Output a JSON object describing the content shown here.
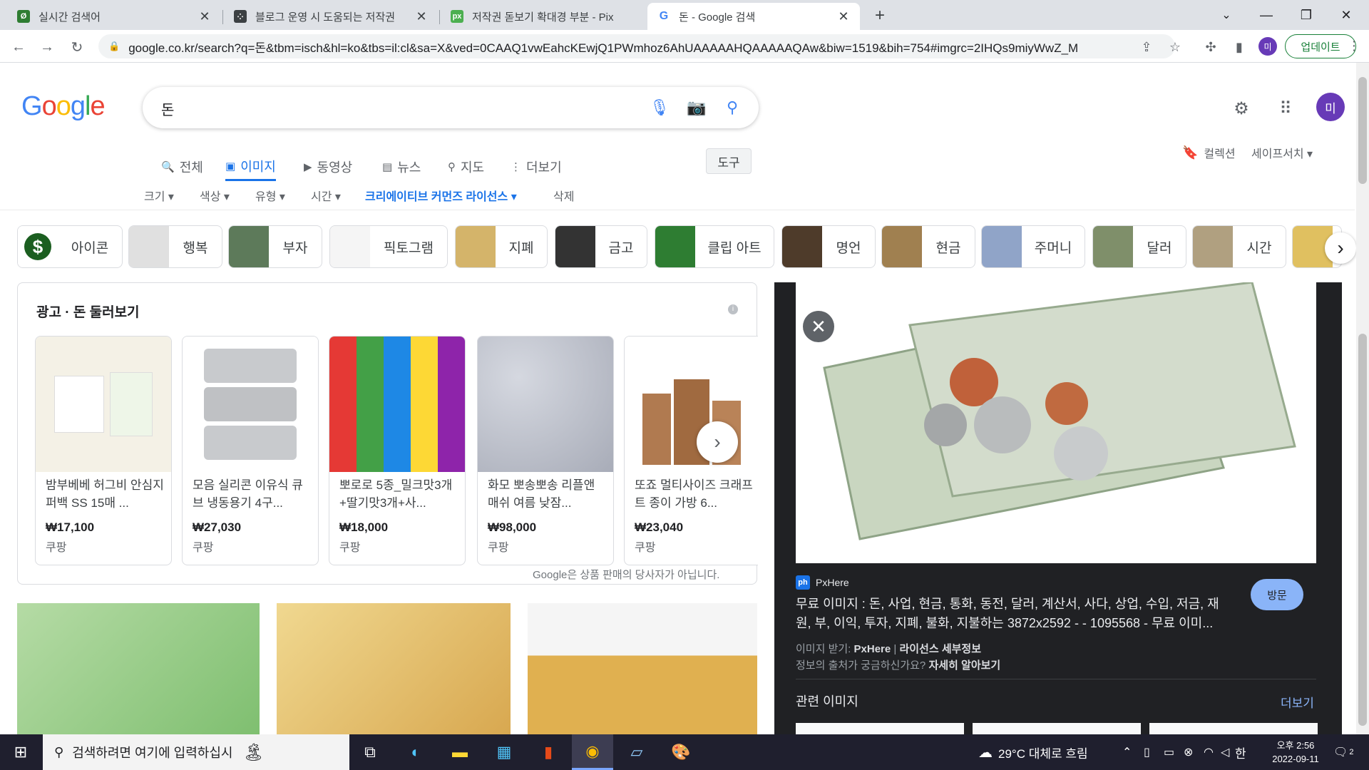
{
  "browser": {
    "tabs": [
      {
        "title": "실시간 검색어",
        "favicon_color": "#2e7d32",
        "favicon_glyph": "Ø"
      },
      {
        "title": "블로그 운영 시 도움되는 저작권",
        "favicon_color": "#3c4043",
        "favicon_glyph": "⁘"
      },
      {
        "title": "저작권 돋보기 확대경 부분 - Pix",
        "favicon_color": "#4caf50",
        "favicon_glyph": "px"
      },
      {
        "title": "돈 - Google 검색",
        "favicon_color": "#ffffff",
        "favicon_glyph": "G"
      }
    ],
    "url": "google.co.kr/search?q=돈&tbm=isch&hl=ko&tbs=il:cl&sa=X&ved=0CAAQ1vwEahcKEwjQ1PWmhoz6AhUAAAAAHQAAAAAQAw&biw=1519&bih=754#imgrc=2IHQs9miyWwZ_M",
    "profile_initial": "미",
    "update_label": "업데이트"
  },
  "google": {
    "logo": "Google",
    "query": "돈",
    "avatar_initial": "미",
    "tabs": [
      {
        "icon": "🔍",
        "label": "전체"
      },
      {
        "icon": "▣",
        "label": "이미지"
      },
      {
        "icon": "▶",
        "label": "동영상"
      },
      {
        "icon": "▤",
        "label": "뉴스"
      },
      {
        "icon": "⚲",
        "label": "지도"
      },
      {
        "icon": "⋮",
        "label": "더보기"
      }
    ],
    "tools_label": "도구",
    "collections_label": "컬렉션",
    "safesearch_label": "세이프서치 ▾",
    "filters": [
      "크기 ▾",
      "색상 ▾",
      "유형 ▾",
      "시간 ▾",
      "크리에이티브 커먼즈 라이선스 ▾",
      "삭제"
    ],
    "chips": [
      {
        "label": "아이콘",
        "color": "#1b5e20"
      },
      {
        "label": "행복",
        "color": "#e0e0e0"
      },
      {
        "label": "부자",
        "color": "#5d7a5a"
      },
      {
        "label": "픽토그램",
        "color": "#f5f5f5"
      },
      {
        "label": "지폐",
        "color": "#d4b46a"
      },
      {
        "label": "금고",
        "color": "#333333"
      },
      {
        "label": "클립 아트",
        "color": "#2e7d32"
      },
      {
        "label": "명언",
        "color": "#4e3b2a"
      },
      {
        "label": "현금",
        "color": "#a08050"
      },
      {
        "label": "주머니",
        "color": "#90a4c8"
      },
      {
        "label": "달러",
        "color": "#7f8f6a"
      },
      {
        "label": "시간",
        "color": "#b0a080"
      },
      {
        "label": "",
        "color": "#e0c060"
      }
    ]
  },
  "ads": {
    "title": "광고 · 돈 둘러보기",
    "disclaimer": "Google은 상품 판매의 당사자가 아닙니다.",
    "items": [
      {
        "name": "밤부베베 허그비 안심지퍼백 SS 15매 ...",
        "price": "₩17,100",
        "seller": "쿠팡",
        "color": "#f4f1e6"
      },
      {
        "name": "모음 실리콘 이유식 큐브 냉동용기 4구...",
        "price": "₩27,030",
        "seller": "쿠팡",
        "color": "#c8cacd"
      },
      {
        "name": "뽀로로 5종_밀크맛3개+딸기맛3개+사...",
        "price": "₩18,000",
        "seller": "쿠팡",
        "color": "#6fa8dc"
      },
      {
        "name": "화모 뽀송뽀송 리플앤 매쉬 여름 낮잠...",
        "price": "₩98,000",
        "seller": "쿠팡",
        "color": "#b8bcc8"
      },
      {
        "name": "또죠 멀티사이즈 크래프트 종이 가방 6...",
        "price": "₩23,040",
        "seller": "쿠팡",
        "color": "#b07a50"
      }
    ]
  },
  "grid_colors": [
    "#9fcf8f",
    "#e8c870",
    "#e0b050"
  ],
  "panel": {
    "source_icon": "ph",
    "source": "PxHere",
    "title": "무료 이미지 : 돈, 사업, 현금, 통화, 동전, 달러, 계산서, 사다, 상업, 수입, 저금, 재원, 부, 이익, 투자, 지폐, 불화, 지불하는 3872x2592 - - 1095568 - 무료 이미...",
    "visit_label": "방문",
    "license_prefix": "이미지 받기:",
    "license_source": "PxHere",
    "license_link": "라이선스 세부정보",
    "learn_prefix": "정보의 출처가 궁금하신가요?",
    "learn_link": "자세히 알아보기",
    "related_title": "관련 이미지",
    "related_more": "더보기"
  },
  "taskbar": {
    "search_placeholder": "검색하려면 여기에 입력하십시",
    "weather": "29°C  대체로 흐림",
    "ime": "한",
    "time": "오후 2:56",
    "date": "2022-09-11",
    "notifications": "2"
  }
}
